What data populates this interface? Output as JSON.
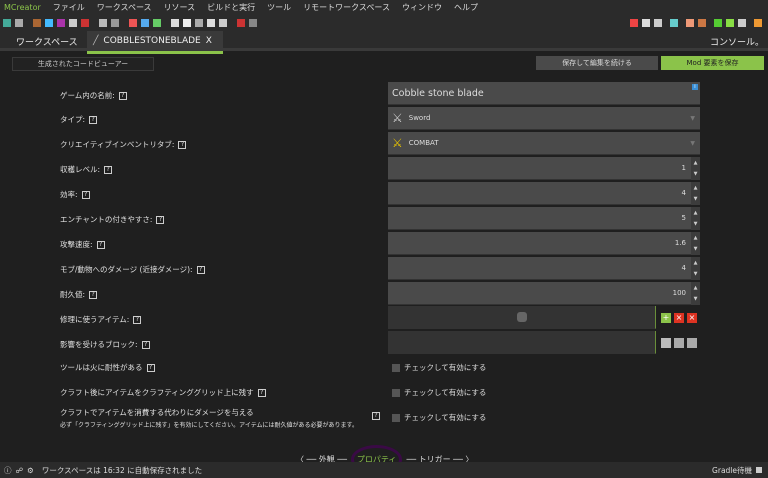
{
  "menu": [
    "MCreator",
    "ファイル",
    "ワークスペース",
    "リソース",
    "ビルドと実行",
    "ツール",
    "リモートワークスペース",
    "ウィンドウ",
    "ヘルプ"
  ],
  "tabs": {
    "workspace": "ワークスペース",
    "element": "COBBLESTONEBLADE",
    "close": "X",
    "console": "コンソール。"
  },
  "buttons": {
    "code_viewer": "生成されたコードビューアー",
    "save_continue": "保存して編集を続ける",
    "save_mod": "Mod 要素を保存"
  },
  "fields": {
    "name": {
      "label": "ゲーム内の名前:",
      "value": "Cobble stone blade"
    },
    "type": {
      "label": "タイプ:",
      "value": "Sword"
    },
    "creative_tab": {
      "label": "クリエイティブインベントリタブ:",
      "value": "COMBAT"
    },
    "harvest_level": {
      "label": "収穫レベル:",
      "value": "1"
    },
    "efficiency": {
      "label": "効率:",
      "value": "4"
    },
    "enchantability": {
      "label": "エンチャントの付きやすさ:",
      "value": "5"
    },
    "attack_speed": {
      "label": "攻撃速度:",
      "value": "1.6"
    },
    "damage": {
      "label": "モブ/動物へのダメージ (近接ダメージ):",
      "value": "4"
    },
    "durability": {
      "label": "耐久値:",
      "value": "100"
    },
    "repair_items": {
      "label": "修理に使うアイテム:"
    },
    "blocks_affected": {
      "label": "影響を受けるブロック:"
    }
  },
  "checks": [
    {
      "label": "ツールは火に耐性がある",
      "text": "チェックして有効にする"
    },
    {
      "label": "クラフト後にアイテムをクラフティンググリッド上に残す",
      "text": "チェックして有効にする"
    },
    {
      "label": "クラフトでアイテムを消費する代わりにダメージを与える",
      "sub": "必ず「クラフティンググリッド上に残す」を有効にしてください。アイテムには耐久値がある必要があります。",
      "text": "チェックして有効にする"
    }
  ],
  "nav": {
    "prev": "〈 ── 外観 ──",
    "current": "プロパティ",
    "next": "── トリガー ── 〉"
  },
  "status": {
    "text": "ワークスペースは 16:32 に自動保存されました",
    "gradle": "Gradle待機"
  },
  "colors": {
    "accent": "#8bc34a",
    "bg": "#1f1f1f",
    "field": "#4a4a4a"
  }
}
